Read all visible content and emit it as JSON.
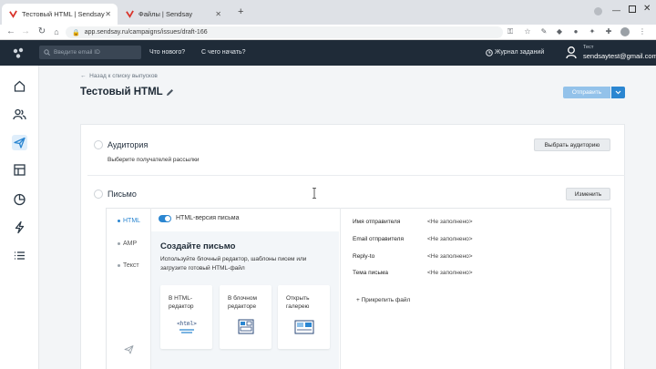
{
  "browser": {
    "tabs": [
      {
        "title": "Тестовый HTML | Sendsay",
        "active": true
      },
      {
        "title": "Файлы | Sendsay",
        "active": false
      }
    ],
    "new_tab": "+",
    "url": "app.sendsay.ru/campaigns/issues/draft-166",
    "nav_back": "←",
    "nav_forward": "→",
    "nav_reload": "↻"
  },
  "header": {
    "search_placeholder": "Введите email ID",
    "links": [
      "Что нового?",
      "С чего начать?"
    ],
    "task_log": "Журнал заданий",
    "user_small": "Тест",
    "user_email": "sendsaytest@gmail.com"
  },
  "page": {
    "back_link": "Назад к списку выпусков",
    "title": "Тестовый HTML",
    "send_button": "Отправить"
  },
  "audience": {
    "title": "Аудитория",
    "subtitle": "Выберите получателей рассылки",
    "button": "Выбрать аудиторию"
  },
  "letter": {
    "title": "Письмо",
    "button": "Изменить",
    "formats": [
      "HTML",
      "AMP",
      "Текст"
    ],
    "toggle_label": "HTML-версия письма",
    "create_title": "Создайте письмо",
    "create_desc": "Используйте блочный редактор, шаблоны писем или загрузите готовый HTML-файл",
    "options": [
      {
        "label": "В HTML-редактор",
        "icon": "html-code-icon"
      },
      {
        "label": "В блочном редакторе",
        "icon": "block-editor-icon"
      },
      {
        "label": "Открыть галерею",
        "icon": "gallery-icon"
      }
    ],
    "fields": [
      {
        "label": "Имя отправителя",
        "value": "<Не заполнено>"
      },
      {
        "label": "Email отправителя",
        "value": "<Не заполнено>"
      },
      {
        "label": "Reply-to",
        "value": "<Не заполнено>"
      },
      {
        "label": "Тема письма",
        "value": "<Не заполнено>"
      }
    ],
    "attach": "Прикрепить файл"
  },
  "colors": {
    "header_bg": "#1f2b38",
    "accent": "#2b86d1",
    "send_disabled": "#93c2ea"
  }
}
